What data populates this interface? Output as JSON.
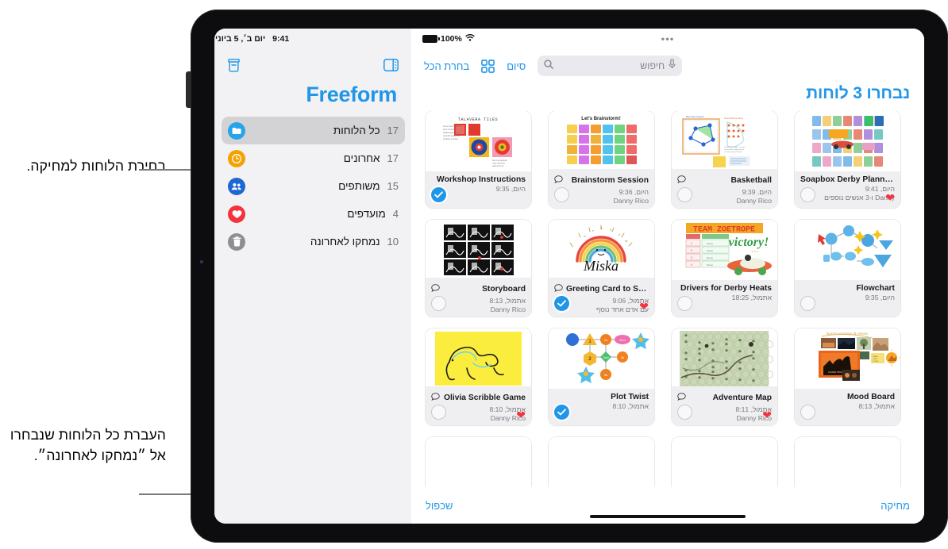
{
  "annotations": {
    "top": "בחירת הלוחות למחיקה.",
    "bottom": "העברת כל הלוחות שנבחרו אל ״נמחקו לאחרונה״."
  },
  "sidebar": {
    "status_time": "9:41",
    "status_date": "יום ב׳, 5 ביוני",
    "archive_icon": "archive-box-icon",
    "sidebar_toggle_icon": "sidebar-toggle-icon",
    "app_title": "Freeform",
    "items": [
      {
        "label": "כל הלוחות",
        "count": "17",
        "icon": "folder-icon",
        "color": "#27a4e8",
        "selected": true
      },
      {
        "label": "אחרונים",
        "count": "17",
        "icon": "clock-icon",
        "color": "#f5a200",
        "selected": false
      },
      {
        "label": "משותפים",
        "count": "15",
        "icon": "people-icon",
        "color": "#1d66d6",
        "selected": false
      },
      {
        "label": "מועדפים",
        "count": "4",
        "icon": "heart-icon",
        "color": "#f4333d",
        "selected": false
      },
      {
        "label": "נמחקו לאחרונה",
        "count": "10",
        "icon": "trash-icon",
        "color": "#8e8e93",
        "selected": false
      }
    ]
  },
  "main": {
    "battery_percent": "100%",
    "wifi_icon": "wifi-icon",
    "more_icon": "more-dots-icon",
    "toolbar": {
      "select_all": "בחרת הכל",
      "grid_view_icon": "grid-view-icon",
      "done": "סיום",
      "search_placeholder": "חיפוש",
      "search_icon": "search-icon",
      "mic_icon": "microphone-icon"
    },
    "heading": "נבחרו 3 לוחות",
    "bottom_bar": {
      "delete": "מחיקה",
      "duplicate": "שכפול"
    },
    "boards": [
      {
        "title": "Workshop Instructions",
        "time": "היום, 9:35",
        "owner": "",
        "selected": true,
        "favorite": false,
        "comment": false,
        "art": "talavera"
      },
      {
        "title": "Brainstorm Session",
        "time": "היום, 9:36",
        "owner": "Danny Rico",
        "selected": false,
        "favorite": false,
        "comment": true,
        "art": "stickies"
      },
      {
        "title": "Basketball",
        "time": "היום, 9:39",
        "owner": "Danny Rico",
        "selected": false,
        "favorite": false,
        "comment": true,
        "art": "court"
      },
      {
        "title": "Soapbox Derby Plannin…",
        "time": "היום, 9:41",
        "owner": "Danny ו-3 אנשים נוספים",
        "selected": false,
        "favorite": true,
        "comment": false,
        "art": "derby"
      },
      {
        "title": "Storyboard",
        "time": "אתמול, 8:13",
        "owner": "Danny Rico",
        "selected": false,
        "favorite": false,
        "comment": true,
        "art": "storyboard"
      },
      {
        "title": "Greeting Card to Sign",
        "time": "אתמול, 9:06",
        "owner": "עם אדם אחד נוסף",
        "selected": true,
        "favorite": true,
        "comment": true,
        "art": "rainbow"
      },
      {
        "title": "Drivers for Derby Heats",
        "time": "אתמול, 18:25",
        "owner": "",
        "selected": false,
        "favorite": false,
        "comment": false,
        "art": "zoetrope"
      },
      {
        "title": "Flowchart",
        "time": "היום, 9:35",
        "owner": "",
        "selected": false,
        "favorite": false,
        "comment": false,
        "art": "flowchart"
      },
      {
        "title": "Olivia Scribble Game",
        "time": "אתמול, 8:10",
        "owner": "Danny Rico",
        "selected": false,
        "favorite": true,
        "comment": true,
        "art": "scribble"
      },
      {
        "title": "Plot Twist",
        "time": "אתמול, 8:10",
        "owner": "",
        "selected": true,
        "favorite": false,
        "comment": false,
        "art": "plot"
      },
      {
        "title": "Adventure Map",
        "time": "אתמול, 8:11",
        "owner": "Danny Rico",
        "selected": false,
        "favorite": true,
        "comment": true,
        "art": "map"
      },
      {
        "title": "Mood Board",
        "time": "אתמול, 8:13",
        "owner": "",
        "selected": false,
        "favorite": false,
        "comment": false,
        "art": "mood"
      }
    ],
    "thumb_labels": {
      "talavera": "TALAVERA TILES",
      "stickies": "Let's Brainstorm!",
      "zoetrope": "TEAM ZOETROPE",
      "zoetrope2": "victory!"
    }
  },
  "colors": {
    "accent": "#2196e8",
    "favorite": "#f4333d",
    "selected_row": "#d3d3d6"
  }
}
